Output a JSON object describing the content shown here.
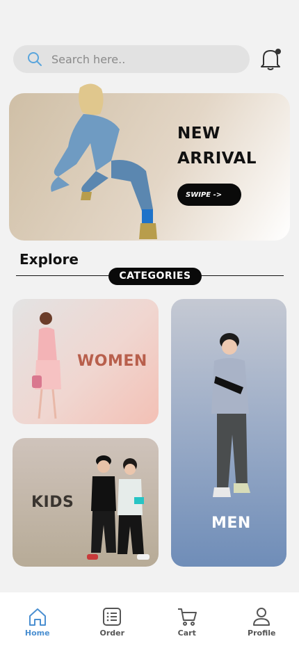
{
  "search": {
    "placeholder": "Search here.."
  },
  "hero": {
    "title_line1": "NEW",
    "title_line2": "ARRIVAL",
    "button_label": "SWIPE ->"
  },
  "explore": {
    "title": "Explore",
    "categories_label": "CATEGORIES"
  },
  "categories": [
    {
      "label": "WOMEN"
    },
    {
      "label": "KIDS"
    },
    {
      "label": "MEN"
    }
  ],
  "tabbar": {
    "items": [
      {
        "label": "Home",
        "icon": "home-icon",
        "active": true
      },
      {
        "label": "Order",
        "icon": "list-icon",
        "active": false
      },
      {
        "label": "Cart",
        "icon": "cart-icon",
        "active": false
      },
      {
        "label": "Profile",
        "icon": "user-icon",
        "active": false
      }
    ]
  },
  "colors": {
    "accent": "#4a8fd1",
    "dark": "#0a0a0a",
    "women_label": "#b85f4c"
  }
}
